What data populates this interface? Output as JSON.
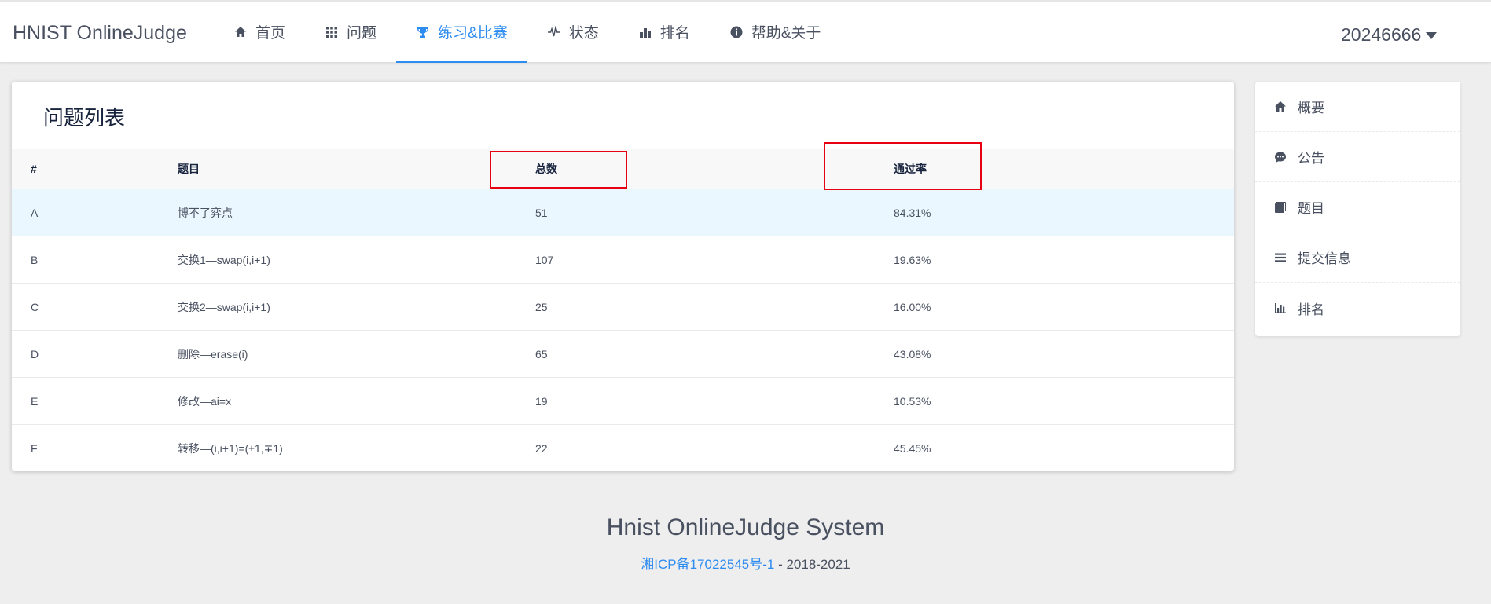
{
  "app": {
    "logo": "HNIST OnlineJudge"
  },
  "nav": {
    "items": [
      {
        "label": "首页",
        "icon": "home-icon"
      },
      {
        "label": "问题",
        "icon": "grid-icon"
      },
      {
        "label": "练习&比赛",
        "icon": "trophy-icon",
        "active": true
      },
      {
        "label": "状态",
        "icon": "pulse-icon"
      },
      {
        "label": "排名",
        "icon": "bar-chart-icon"
      },
      {
        "label": "帮助&关于",
        "icon": "info-icon"
      }
    ],
    "user": "20246666"
  },
  "panel": {
    "title": "问题列表",
    "columns": {
      "id": "#",
      "title": "题目",
      "total": "总数",
      "rate": "通过率"
    },
    "rows": [
      {
        "id": "A",
        "title": "博不了弈点",
        "total": "51",
        "rate": "84.31%"
      },
      {
        "id": "B",
        "title": "交换1—swap(i,i+1)",
        "total": "107",
        "rate": "19.63%"
      },
      {
        "id": "C",
        "title": "交换2—swap(i,i+1)",
        "total": "25",
        "rate": "16.00%"
      },
      {
        "id": "D",
        "title": "删除—erase(i)",
        "total": "65",
        "rate": "43.08%"
      },
      {
        "id": "E",
        "title": "修改—ai=x",
        "total": "19",
        "rate": "10.53%"
      },
      {
        "id": "F",
        "title": "转移—(i,i+1)=(±1,∓1)",
        "total": "22",
        "rate": "45.45%"
      }
    ]
  },
  "side": {
    "items": [
      {
        "label": "概要",
        "icon": "home-icon"
      },
      {
        "label": "公告",
        "icon": "chat-bubble-icon"
      },
      {
        "label": "题目",
        "icon": "book-icon"
      },
      {
        "label": "提交信息",
        "icon": "list-icon"
      },
      {
        "label": "排名",
        "icon": "bar-chart-icon"
      }
    ]
  },
  "footer": {
    "title": "Hnist OnlineJudge System",
    "icp": "湘ICP备17022545号-1",
    "years": " - 2018-2021"
  },
  "colors": {
    "accent": "#2d8cf0",
    "highlight_row": "#ebf7ff",
    "annotation": "#e60012"
  }
}
